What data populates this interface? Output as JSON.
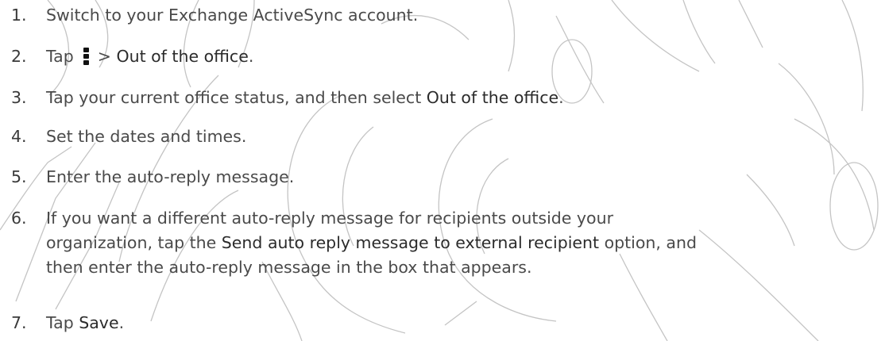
{
  "steps": [
    {
      "num": "1.",
      "text": "Switch to your Exchange ActiveSync account."
    },
    {
      "num": "2.",
      "pre": "Tap ",
      "mid": " > ",
      "cmd": "Out of the office",
      "post": ".",
      "icon": "overflow-menu-icon"
    },
    {
      "num": "3.",
      "pre": "Tap your current office status, and then select ",
      "cmd": "Out of the office",
      "post": "."
    },
    {
      "num": "4.",
      "text": "Set the dates and times."
    },
    {
      "num": "5.",
      "text": "Enter the auto-reply message."
    },
    {
      "num": "6.",
      "line1": "If you want a different auto-reply message for recipients outside your",
      "line2_pre": "organization, tap the ",
      "line2_cmd": "Send auto reply message to external recipient",
      "line2_post": " option, and",
      "line3": "then enter the auto-reply message in the box that appears."
    },
    {
      "num": "7.",
      "pre": "Tap ",
      "cmd": "Save",
      "post": "."
    }
  ],
  "watermark": {
    "color": "#c4c4c4"
  }
}
